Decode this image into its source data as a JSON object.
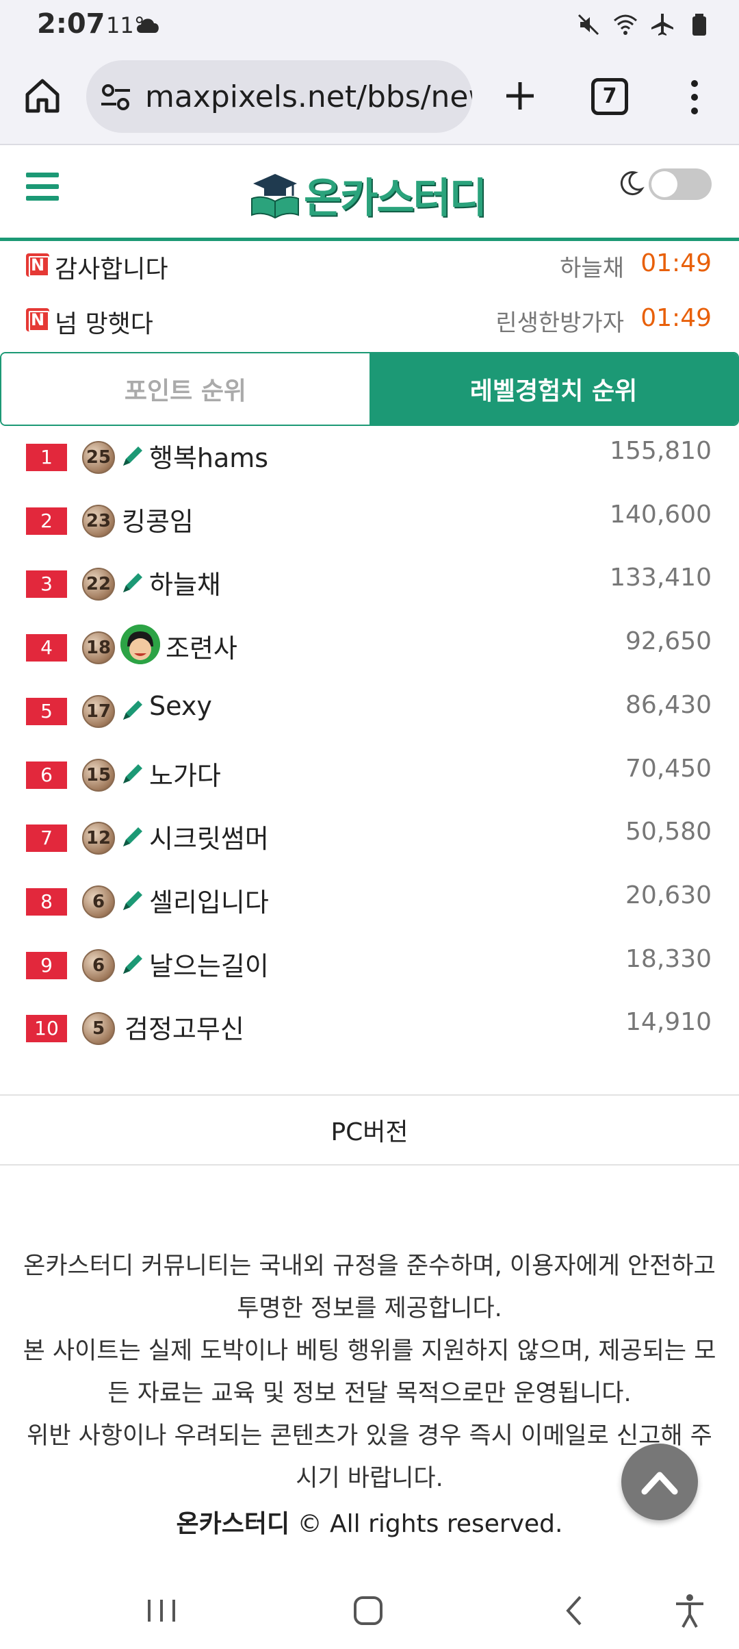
{
  "status_bar": {
    "time": "2:07",
    "temperature": "11°",
    "icons": [
      "weather-icon",
      "mute-icon",
      "wifi-icon",
      "airplane-icon",
      "battery-icon"
    ]
  },
  "browser": {
    "url": "maxpixels.net/bbs/new",
    "tab_count": "7",
    "icons": [
      "home-icon",
      "site-settings-icon",
      "new-tab-icon",
      "tabs-icon",
      "more-menu-icon"
    ]
  },
  "site": {
    "logo_text": "온카스터디",
    "brand_color": "#1c9975",
    "icons": [
      "menu-icon",
      "moon-icon"
    ],
    "dark_mode_on": false
  },
  "recent_posts": [
    {
      "badge": "N",
      "title": "감사합니다",
      "author": "하늘채",
      "time": "01:49"
    },
    {
      "badge": "N",
      "title": "넘 망햇다",
      "author": "린생한방가자",
      "time": "01:49"
    }
  ],
  "tabs": {
    "points": "포인트 순위",
    "level_exp": "레벨경험치 순위",
    "active": "level_exp"
  },
  "ranking": [
    {
      "rank": "1",
      "level": "25",
      "pencil": true,
      "avatar": false,
      "nick": "행복hams",
      "score": "155,810"
    },
    {
      "rank": "2",
      "level": "23",
      "pencil": false,
      "avatar": false,
      "nick": "킹콩임",
      "score": "140,600"
    },
    {
      "rank": "3",
      "level": "22",
      "pencil": true,
      "avatar": false,
      "nick": "하늘채",
      "score": "133,410"
    },
    {
      "rank": "4",
      "level": "18",
      "pencil": false,
      "avatar": true,
      "nick": "조련사",
      "score": "92,650"
    },
    {
      "rank": "5",
      "level": "17",
      "pencil": true,
      "avatar": false,
      "nick": "Sexy",
      "score": "86,430"
    },
    {
      "rank": "6",
      "level": "15",
      "pencil": true,
      "avatar": false,
      "nick": "노가다",
      "score": "70,450"
    },
    {
      "rank": "7",
      "level": "12",
      "pencil": true,
      "avatar": false,
      "nick": "시크릿썸머",
      "score": "50,580"
    },
    {
      "rank": "8",
      "level": "6",
      "pencil": true,
      "avatar": false,
      "nick": "셀리입니다",
      "score": "20,630"
    },
    {
      "rank": "9",
      "level": "6",
      "pencil": true,
      "avatar": false,
      "nick": "날으는길이",
      "score": "18,330"
    },
    {
      "rank": "10",
      "level": "5",
      "pencil": false,
      "avatar": false,
      "nick": "검정고무신",
      "score": "14,910"
    }
  ],
  "footer": {
    "pc_version": "PC버전",
    "disclaimer_lines": [
      "온카스터디 커뮤니티는 국내외 규정을 준수하며, 이용자에게 안전하고",
      "투명한 정보를 제공합니다.",
      "본 사이트는 실제 도박이나 베팅 행위를 지원하지 않으며, 제공되는 모",
      "든 자료는 교육 및 정보 전달 목적으로만 운영됩니다.",
      "위반 사항이나 우려되는 콘텐츠가 있을 경우 즉시 이메일로 신고해 주",
      "시기 바랍니다."
    ],
    "copyright_brand": "온카스터디",
    "copyright_text": "© All rights reserved."
  },
  "nav_bar": {
    "icons": [
      "recent-apps-icon",
      "home-nav-icon",
      "back-icon",
      "accessibility-icon"
    ]
  }
}
